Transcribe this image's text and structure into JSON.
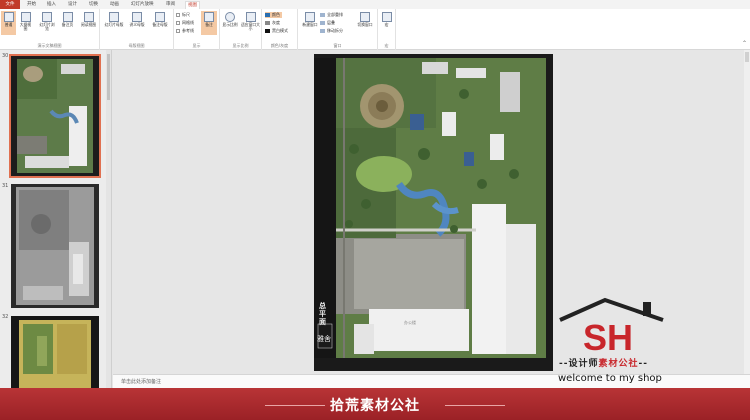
{
  "tabs": [
    {
      "label": "文件",
      "kind": "file"
    },
    {
      "label": "开始"
    },
    {
      "label": "插入"
    },
    {
      "label": "设计"
    },
    {
      "label": "切换"
    },
    {
      "label": "动画"
    },
    {
      "label": "幻灯片放映"
    },
    {
      "label": "审阅"
    },
    {
      "label": "视图",
      "active": true
    }
  ],
  "ribbon": {
    "presentation_views": {
      "label": "演示文稿视图",
      "buttons": [
        "普通",
        "大纲视图",
        "幻灯片浏览",
        "备注页",
        "阅读视图"
      ]
    },
    "master_views": {
      "label": "母版视图",
      "buttons": [
        "幻灯片母版",
        "讲义母版",
        "备注母版"
      ]
    },
    "show": {
      "label": "显示",
      "checks": [
        "标尺",
        "网格线",
        "参考线"
      ],
      "button": "备注"
    },
    "zoom": {
      "label": "显示比例",
      "buttons": [
        "显示比例",
        "适应窗口大小"
      ]
    },
    "color": {
      "label": "颜色/灰度",
      "items": [
        "颜色",
        "灰度",
        "黑白模式"
      ]
    },
    "window": {
      "label": "窗口",
      "new_window": "新建窗口",
      "items": [
        "全部重排",
        "层叠",
        "移动拆分"
      ],
      "switch": "切换窗口"
    },
    "macro": {
      "label": "宏",
      "button": "宏"
    }
  },
  "thumbnails": [
    {
      "number": "30",
      "selected": true
    },
    {
      "number": "31",
      "selected": false
    },
    {
      "number": "32",
      "selected": false
    }
  ],
  "slide": {
    "title_vertical": "总平面",
    "seal_text": "雅舍",
    "building_label": "办公楼"
  },
  "notes_placeholder": "单击此处添加备注",
  "banner": {
    "text": "拾荒素材公社"
  },
  "watermark": {
    "logo_letters": "SH",
    "subtitle_black": "设计师",
    "subtitle_red": "素材公社",
    "welcome": "welcome to my shop"
  },
  "colors": {
    "accent": "#c13a2a",
    "banner": "#a7282c",
    "selected_button": "#f4c9a4"
  }
}
